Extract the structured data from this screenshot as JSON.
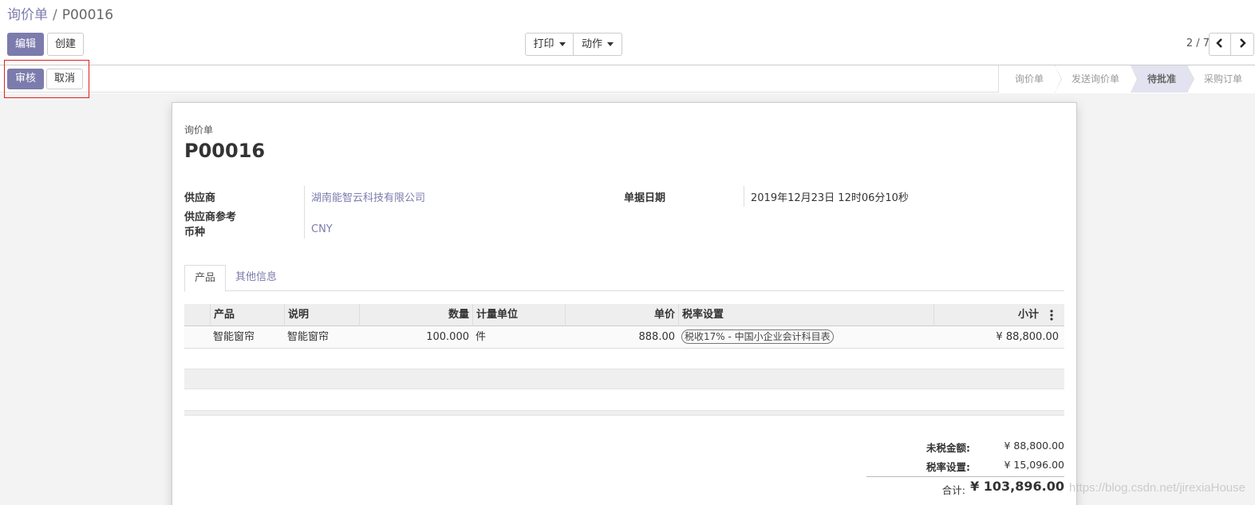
{
  "breadcrumb": {
    "parent": "询价单",
    "separator": "/",
    "current": "P00016"
  },
  "toolbar": {
    "edit_label": "编辑",
    "create_label": "创建",
    "print_label": "打印",
    "action_label": "动作",
    "pager": "2 / 7",
    "prev_icon": "chevron-left",
    "next_icon": "chevron-right"
  },
  "statusbar": {
    "approve_label": "审核",
    "cancel_label": "取消",
    "stages": [
      "询价单",
      "发送询价单",
      "待批准",
      "采购订单"
    ],
    "active_stage": "待批准"
  },
  "form": {
    "doc_type": "询价单",
    "doc_name": "P00016",
    "fields": {
      "vendor_label": "供应商",
      "vendor_value": "湖南能智云科技有限公司",
      "vendor_ref_label": "供应商参考",
      "currency_label": "币种",
      "currency_value": "CNY",
      "date_label": "单据日期",
      "date_value": "2019年12月23日 12时06分10秒"
    },
    "tabs": [
      "产品",
      "其他信息"
    ],
    "table": {
      "headers": [
        "产品",
        "说明",
        "数量",
        "计量单位",
        "单价",
        "税率设置",
        "小计"
      ],
      "rows": [
        {
          "product": "智能窗帘",
          "description": "智能窗帘",
          "quantity": "100.000",
          "uom": "件",
          "unit_price": "888.00",
          "tax": "税收17% - 中国小企业会计科目表",
          "subtotal": "¥ 88,800.00"
        }
      ]
    },
    "totals": {
      "untaxed_label": "未税金额:",
      "untaxed_value": "¥ 88,800.00",
      "tax_label": "税率设置:",
      "tax_value": "¥ 15,096.00",
      "total_label": "合计:",
      "total_value": "¥ 103,896.00"
    }
  },
  "watermark": "https://blog.csdn.net/jirexiaHouse",
  "colors": {
    "accent": "#7c7bad",
    "highlight": "#e02020"
  }
}
